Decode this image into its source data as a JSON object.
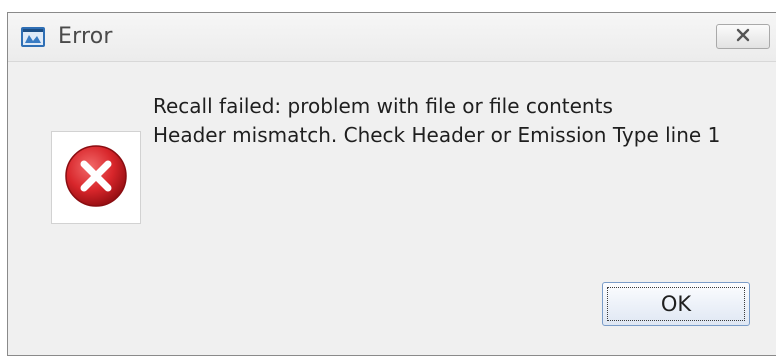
{
  "dialog": {
    "title": "Error",
    "close_icon": "close-icon",
    "app_icon": "app-window-icon",
    "status_icon": "error-icon",
    "messages": [
      "Recall failed: problem with file or file contents",
      "Header mismatch. Check Header or Emission Type line 1"
    ],
    "ok_label": "OK"
  },
  "colors": {
    "error_red": "#d8262b",
    "button_focus_border": "#7a9cc8"
  }
}
